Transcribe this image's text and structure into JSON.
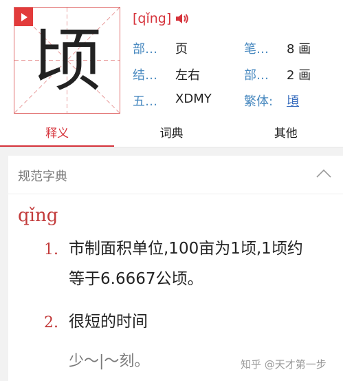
{
  "header": {
    "character": "顷",
    "pinyin": "[qǐng]",
    "info": [
      {
        "label": "部…",
        "value": "页"
      },
      {
        "label": "笔…",
        "value": "8 画"
      },
      {
        "label": "结…",
        "value": "左右"
      },
      {
        "label": "部…",
        "value": "2 画"
      },
      {
        "label": "五…",
        "value": "XDMY"
      },
      {
        "label": "繁体:",
        "value": "頃"
      }
    ]
  },
  "tabs": [
    {
      "label": "释义",
      "active": true
    },
    {
      "label": "词典",
      "active": false
    },
    {
      "label": "其他",
      "active": false
    }
  ],
  "definition_card": {
    "title": "规范字典",
    "pinyin": "qǐng",
    "entries": [
      {
        "num": "1.",
        "lines": [
          "市制面积单位,100亩为1顷,1顷约",
          "等于6.6667公顷。"
        ]
      },
      {
        "num": "2.",
        "lines": [
          "很短的时间"
        ],
        "example": "少～|～刻。"
      }
    ]
  },
  "watermark": "知乎 @天才第一步",
  "colors": {
    "accent_red": "#d6333b",
    "label_blue": "#4a8ac0",
    "link_blue": "#3b6fbf",
    "band_gray": "#f2f2f2"
  }
}
